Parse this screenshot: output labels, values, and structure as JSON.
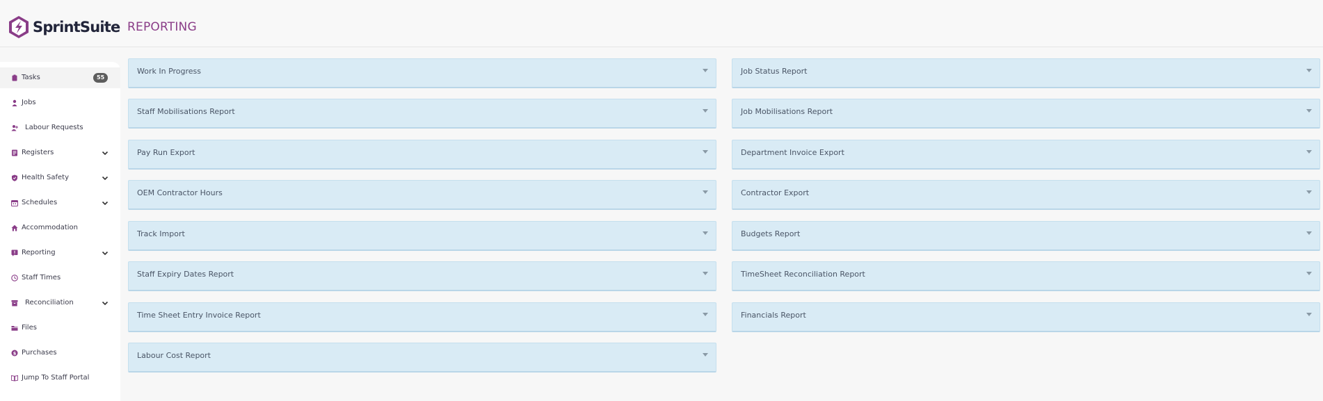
{
  "brand": {
    "name": "SprintSuite",
    "accent": "#8a3d88"
  },
  "header": {
    "title": "REPORTING"
  },
  "sidebar": {
    "items": [
      {
        "label": "Tasks",
        "icon": "clipboard-icon",
        "badge": "55",
        "expandable": false
      },
      {
        "label": "Jobs",
        "icon": "person-icon",
        "expandable": false
      },
      {
        "label": "Labour Requests",
        "icon": "user-plus-icon",
        "expandable": false
      },
      {
        "label": "Registers",
        "icon": "register-icon",
        "expandable": true
      },
      {
        "label": "Health Safety",
        "icon": "shield-icon",
        "expandable": true
      },
      {
        "label": "Schedules",
        "icon": "calendar-icon",
        "expandable": true
      },
      {
        "label": "Accommodation",
        "icon": "home-icon",
        "expandable": false
      },
      {
        "label": "Reporting",
        "icon": "report-alert-icon",
        "expandable": true
      },
      {
        "label": "Staff Times",
        "icon": "clock-icon",
        "expandable": false
      },
      {
        "label": "Reconciliation",
        "icon": "archive-icon",
        "expandable": true
      },
      {
        "label": "Files",
        "icon": "folder-icon",
        "expandable": false
      },
      {
        "label": "Purchases",
        "icon": "dollar-icon",
        "expandable": false
      },
      {
        "label": "Jump To Staff Portal",
        "icon": "book-icon",
        "expandable": false
      }
    ]
  },
  "reports": {
    "left": [
      "Work In Progress",
      "Staff Mobilisations Report",
      "Pay Run Export",
      "OEM Contractor Hours",
      "Track Import",
      "Staff Expiry Dates Report",
      "Time Sheet Entry Invoice Report",
      "Labour Cost Report"
    ],
    "right": [
      "Job Status Report",
      "Job Mobilisations Report",
      "Department Invoice Export",
      "Contractor Export",
      "Budgets Report",
      "TimeSheet Reconciliation Report",
      "Financials Report"
    ]
  }
}
